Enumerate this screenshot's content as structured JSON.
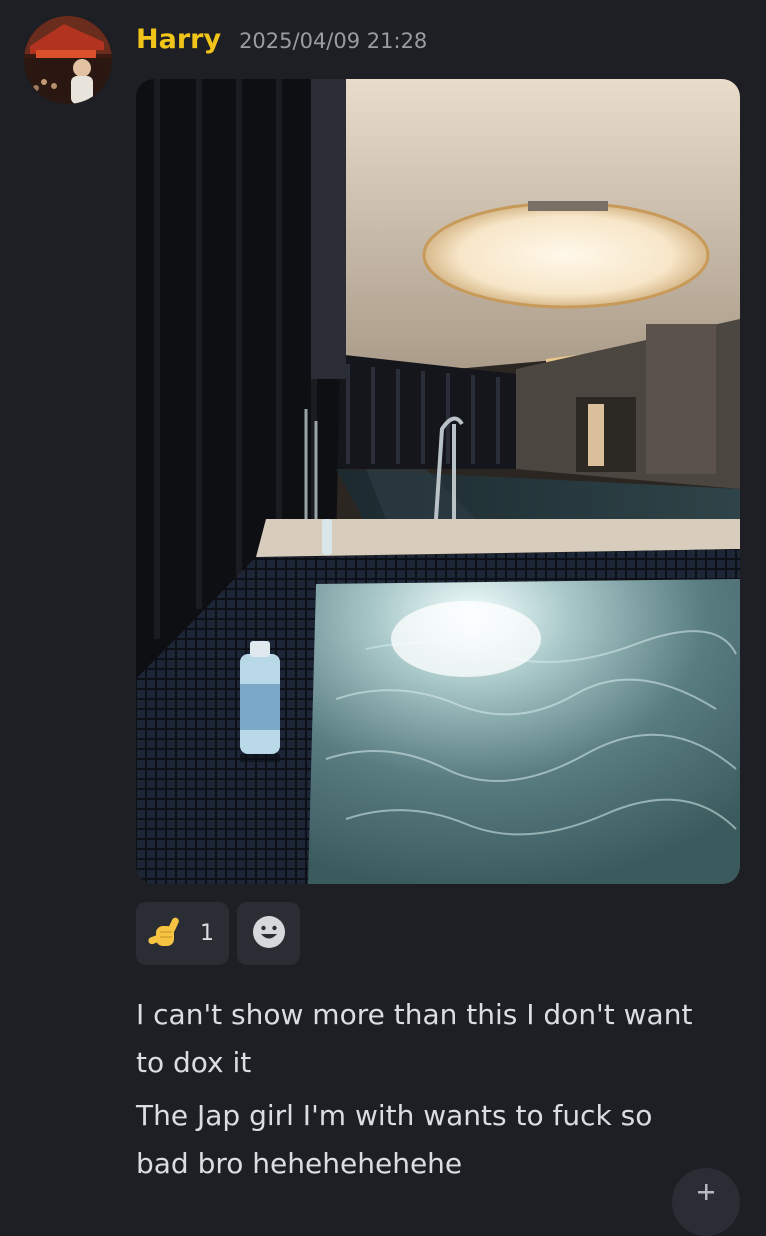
{
  "message": {
    "author": "Harry",
    "timestamp": "2025/04/09 21:28",
    "avatar_icon": "user-avatar",
    "author_color": "#f0c419",
    "attachment": {
      "kind": "photo",
      "subject": "indoor-pool-jacuzzi"
    },
    "reactions": [
      {
        "emoji": "call-me-hand-icon",
        "count": "1"
      }
    ],
    "add_reaction_icon": "smiley-add-icon",
    "text_lines": [
      "I can't show more than this I don't want",
      "to dox it",
      "The Jap girl I'm with wants to fuck so",
      "bad bro hehehehehehe"
    ]
  },
  "fab_icon": "plus-icon",
  "colors": {
    "background": "#1e1f24",
    "reaction_bg": "#2b2d34",
    "timestamp": "#9a9ca3",
    "text": "#dbdee1"
  }
}
